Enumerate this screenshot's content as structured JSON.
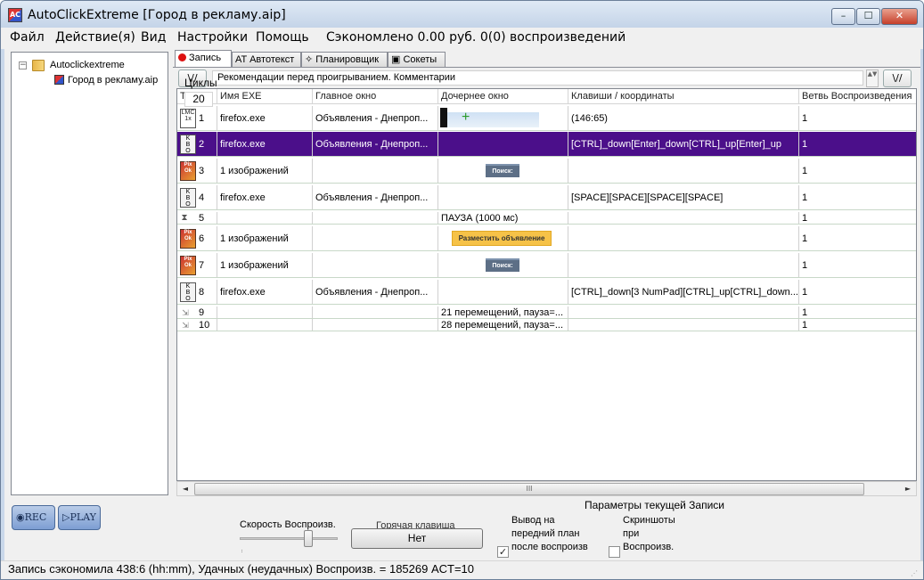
{
  "window": {
    "title": "AutoClickExtreme [Город в рекламу.aip]",
    "controls": {
      "minimize": "–",
      "maximize": "☐",
      "close": "✕"
    },
    "app_icon_text": "AC"
  },
  "menu": {
    "file": "Файл",
    "action": "Действие(я)",
    "view": "Вид",
    "settings": "Настройки",
    "help": "Помощь",
    "saved_text": "Сэкономлено 0.00 руб. 0(0) воспроизведений"
  },
  "tree": {
    "expander": "−",
    "root": "Autoclickextreme",
    "file": "Город в рекламу.aip"
  },
  "buttons": {
    "rec": "◉REC",
    "play": "▷PLAY"
  },
  "tabs": {
    "record": "Запись",
    "autotext": "AT Автотекст",
    "scheduler": "✧ Планировщик",
    "sockets": "▣ Сокеты"
  },
  "comment": {
    "collapse_left": "\\//",
    "collapse_right": "\\//",
    "text": "Рекомендации перед проигрыванием. Комментарии",
    "spin": "▲▼"
  },
  "grid": {
    "headers": [
      "Тип д...",
      "Имя EXE",
      "Главное окно",
      "Дочернее окно",
      "Клавиши / координаты",
      "Ветвь Воспроизведения"
    ],
    "rows": [
      {
        "num": "1",
        "icon": "LMC\n1x",
        "icon_type": "mouse-click-icon",
        "exe": "firefox.exe",
        "main": "Объявления - Днепроп...",
        "child": "",
        "keys": "(146:65)",
        "branch": "1",
        "thumb": "screenshot"
      },
      {
        "num": "2",
        "icon": "K\nB\nO",
        "icon_type": "keyboard-icon",
        "exe": "firefox.exe",
        "main": "Объявления - Днепроп...",
        "child": "",
        "keys": "[CTRL]_down[Enter]_down[CTRL]_up[Enter]_up",
        "branch": "1",
        "selected": true
      },
      {
        "num": "3",
        "icon": "Pix\nOk",
        "icon_type": "image-search-icon",
        "exe": "1 изображений",
        "main": "",
        "child": "Поиск:",
        "keys": "",
        "branch": "1",
        "thumb": "gray"
      },
      {
        "num": "4",
        "icon": "K\nB\nO",
        "icon_type": "keyboard-icon",
        "exe": "firefox.exe",
        "main": "Объявления - Днепроп...",
        "child": "",
        "keys": "[SPACE][SPACE][SPACE][SPACE]",
        "branch": "1"
      },
      {
        "num": "5",
        "icon": "⧗",
        "icon_type": "pause-icon",
        "exe": "",
        "main": "",
        "child": "ПАУЗА (1000 мс)",
        "keys": "",
        "branch": "1"
      },
      {
        "num": "6",
        "icon": "Pix\nOk",
        "icon_type": "image-search-icon",
        "exe": "1 изображений",
        "main": "",
        "child": "Разместить объявление",
        "keys": "",
        "branch": "1",
        "thumb": "yellow"
      },
      {
        "num": "7",
        "icon": "Pix\nOk",
        "icon_type": "image-search-icon",
        "exe": "1 изображений",
        "main": "",
        "child": "Поиск:",
        "keys": "",
        "branch": "1",
        "thumb": "gray"
      },
      {
        "num": "8",
        "icon": "K\nB\nO",
        "icon_type": "keyboard-icon",
        "exe": "firefox.exe",
        "main": "Объявления - Днепроп...",
        "child": "",
        "keys": "[CTRL]_down[3 NumPad][CTRL]_up[CTRL]_down...",
        "branch": "1"
      },
      {
        "num": "9",
        "icon": "⇲",
        "icon_type": "mouse-move-icon",
        "exe": "",
        "main": "",
        "child": "21 перемещений, пауза=...",
        "keys": "",
        "branch": "1"
      },
      {
        "num": "10",
        "icon": "⇲",
        "icon_type": "mouse-move-icon",
        "exe": "",
        "main": "",
        "child": "28 перемещений, пауза=...",
        "keys": "",
        "branch": "1"
      }
    ]
  },
  "scroll": {
    "left": "◄",
    "right": "►",
    "grip": "III"
  },
  "params": {
    "title": "Параметры текущей Записи",
    "cycles_label": "Циклы",
    "cycles_value": "20",
    "speed_label": "Скорость Воспроизв.",
    "speed_level": 0.7,
    "hotkey_label": "Горячая клавиша",
    "hotkey_value": "Нет",
    "foreground_label": "Вывод на передний план после воспроизв",
    "foreground_checked": "✓",
    "screenshots_label": "Скриншоты при Воспроизв.",
    "screenshots_checked": ""
  },
  "status": {
    "text": "Запись сэкономила 438:6 (hh:mm), Удачных (неудачных) Воспроизв. = 185269 ACT=10",
    "grip": "⋰"
  }
}
